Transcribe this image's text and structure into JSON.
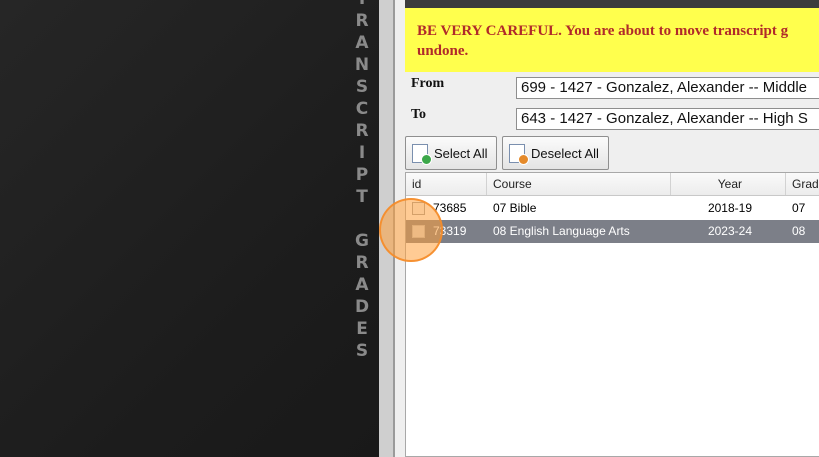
{
  "sidebar_title": {
    "letters_word1": [
      "T",
      "R",
      "A",
      "N",
      "S",
      "C",
      "R",
      "I",
      "P",
      "T"
    ],
    "letters_word2": [
      "G",
      "R",
      "A",
      "D",
      "E",
      "S"
    ]
  },
  "warning": {
    "line1": "BE VERY CAREFUL. You are about to move transcript g",
    "line2": "undone."
  },
  "from": {
    "label": "From",
    "value": "699 - 1427 - Gonzalez, Alexander -- Middle"
  },
  "to": {
    "label": "To",
    "value": "643 - 1427 - Gonzalez, Alexander -- High S"
  },
  "buttons": {
    "select_all": "Select All",
    "deselect_all": "Deselect All"
  },
  "table": {
    "headers": {
      "id": "id",
      "course": "Course",
      "year": "Year",
      "grade": "Grade"
    },
    "rows": [
      {
        "id": "73685",
        "course": "07 Bible",
        "year": "2018-19",
        "grade": "07",
        "selected": false
      },
      {
        "id": "73319",
        "course": "08 English Language Arts",
        "year": "2023-24",
        "grade": "08",
        "selected": true
      }
    ]
  },
  "colors": {
    "warning_bg": "#ffff4d",
    "warning_text": "#b02a2a",
    "selected_row": "#7c7f88",
    "click_highlight": "#f59a3c"
  }
}
